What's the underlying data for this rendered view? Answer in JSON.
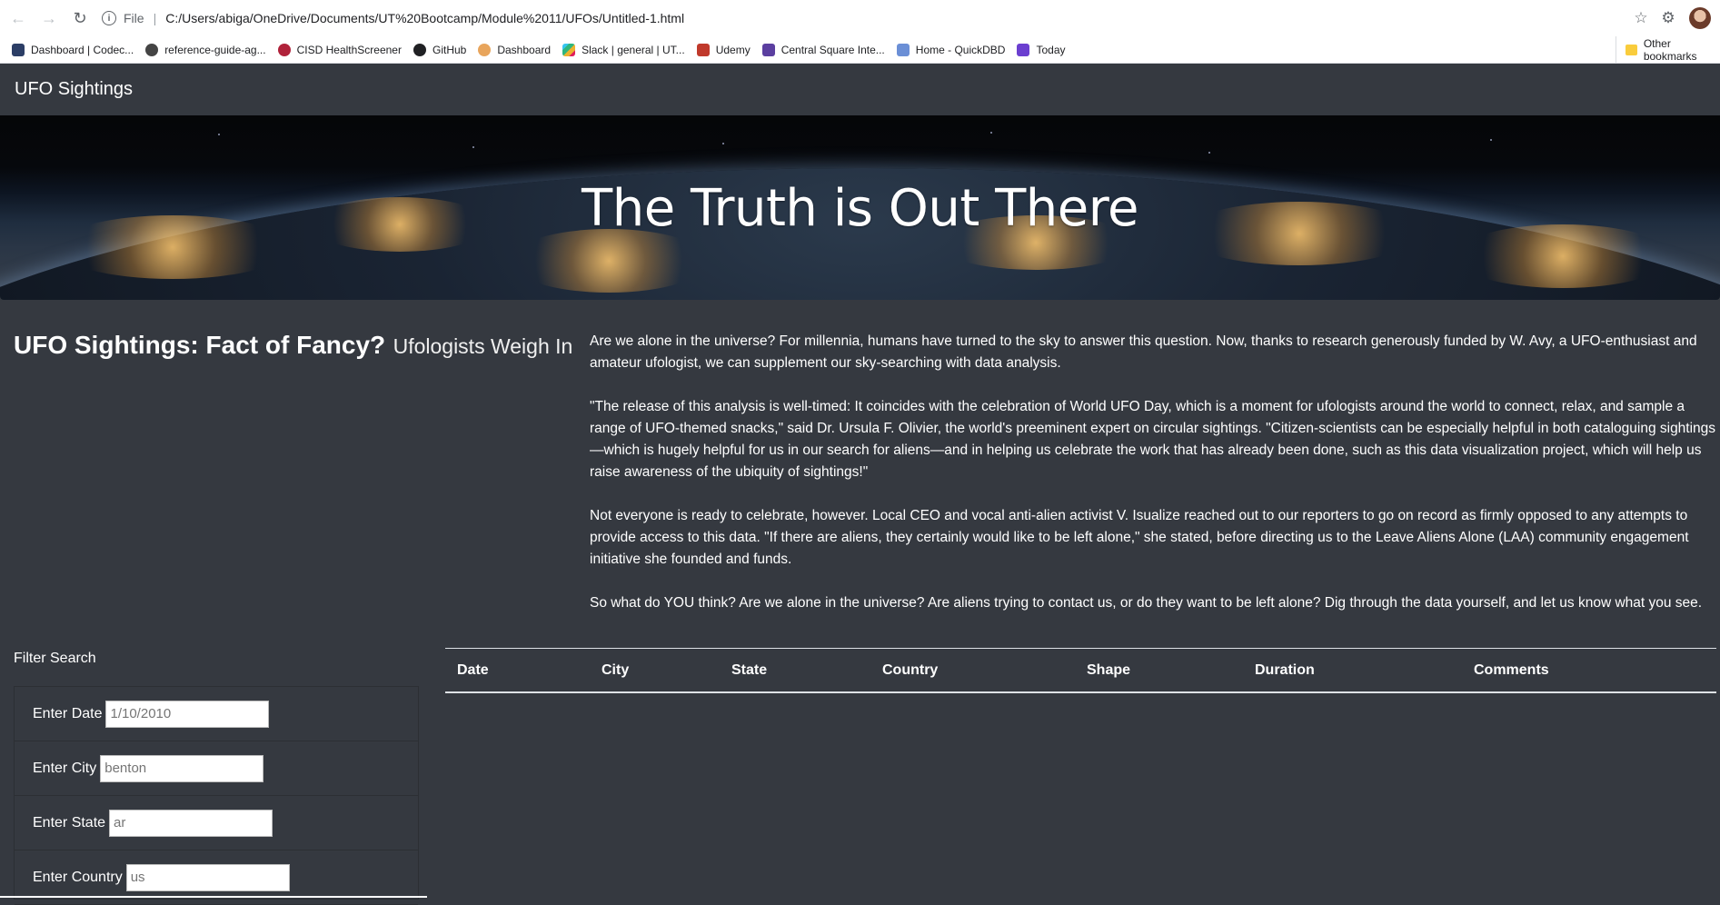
{
  "browser": {
    "address_scheme": "File",
    "url": "C:/Users/abiga/OneDrive/Documents/UT%20Bootcamp/Module%2011/UFOs/Untitled-1.html",
    "bookmarks": [
      {
        "label": "Dashboard | Codec...",
        "icon": "codecademy-icon",
        "color": "#2c3e66"
      },
      {
        "label": "reference-guide-ag...",
        "icon": "globe-icon",
        "color": "#444444"
      },
      {
        "label": "CISD HealthScreener",
        "icon": "healthscreener-icon",
        "color": "#b0223a"
      },
      {
        "label": "GitHub",
        "icon": "github-icon",
        "color": "#202124"
      },
      {
        "label": "Dashboard",
        "icon": "dashboard-icon",
        "color": "#e8a55c"
      },
      {
        "label": "Slack | general | UT...",
        "icon": "slack-icon",
        "color": "#e01e5a"
      },
      {
        "label": "Udemy",
        "icon": "udemy-icon",
        "color": "#c0392b"
      },
      {
        "label": "Central Square Inte...",
        "icon": "central-square-icon",
        "color": "#5b3fa0"
      },
      {
        "label": "Home - QuickDBD",
        "icon": "quickdbd-icon",
        "color": "#6b8fd6"
      },
      {
        "label": "Today",
        "icon": "today-icon",
        "color": "#6b3fd0"
      }
    ],
    "other_bookmarks": "Other bookmarks"
  },
  "navbar": {
    "brand": "UFO Sightings"
  },
  "jumbotron": {
    "title": "The Truth is Out There"
  },
  "intro": {
    "heading_main": "UFO Sightings: Fact of Fancy?",
    "heading_sub": "Ufologists Weigh In",
    "paragraphs": [
      "Are we alone in the universe? For millennia, humans have turned to the sky to answer this question. Now, thanks to research generously funded by W. Avy, a UFO-enthusiast and amateur ufologist, we can supplement our sky-searching with data analysis.",
      "\"The release of this analysis is well-timed: It coincides with the celebration of World UFO Day, which is a moment for ufologists around the world to connect, relax, and sample a range of UFO-themed snacks,\" said Dr. Ursula F. Olivier, the world's preeminent expert on circular sightings. \"Citizen-scientists can be especially helpful in both cataloguing sightings—which is hugely helpful for us in our search for aliens—and in helping us celebrate the work that has already been done, such as this data visualization project, which will help us raise awareness of the ubiquity of sightings!\"",
      "Not everyone is ready to celebrate, however. Local CEO and vocal anti-alien activist V. Isualize reached out to our reporters to go on record as firmly opposed to any attempts to provide access to this data. \"If there are aliens, they certainly would like to be left alone,\" she stated, before directing us to the Leave Aliens Alone (LAA) community engagement initiative she founded and funds.",
      "So what do YOU think? Are we alone in the universe? Are aliens trying to contact us, or do they want to be left alone? Dig through the data yourself, and let us know what you see."
    ]
  },
  "filters": {
    "title": "Filter Search",
    "rows": [
      {
        "label": "Enter Date",
        "placeholder": "1/10/2010"
      },
      {
        "label": "Enter City",
        "placeholder": "benton"
      },
      {
        "label": "Enter State",
        "placeholder": "ar"
      },
      {
        "label": "Enter Country",
        "placeholder": "us"
      }
    ]
  },
  "table": {
    "columns": [
      "Date",
      "City",
      "State",
      "Country",
      "Shape",
      "Duration",
      "Comments"
    ]
  }
}
